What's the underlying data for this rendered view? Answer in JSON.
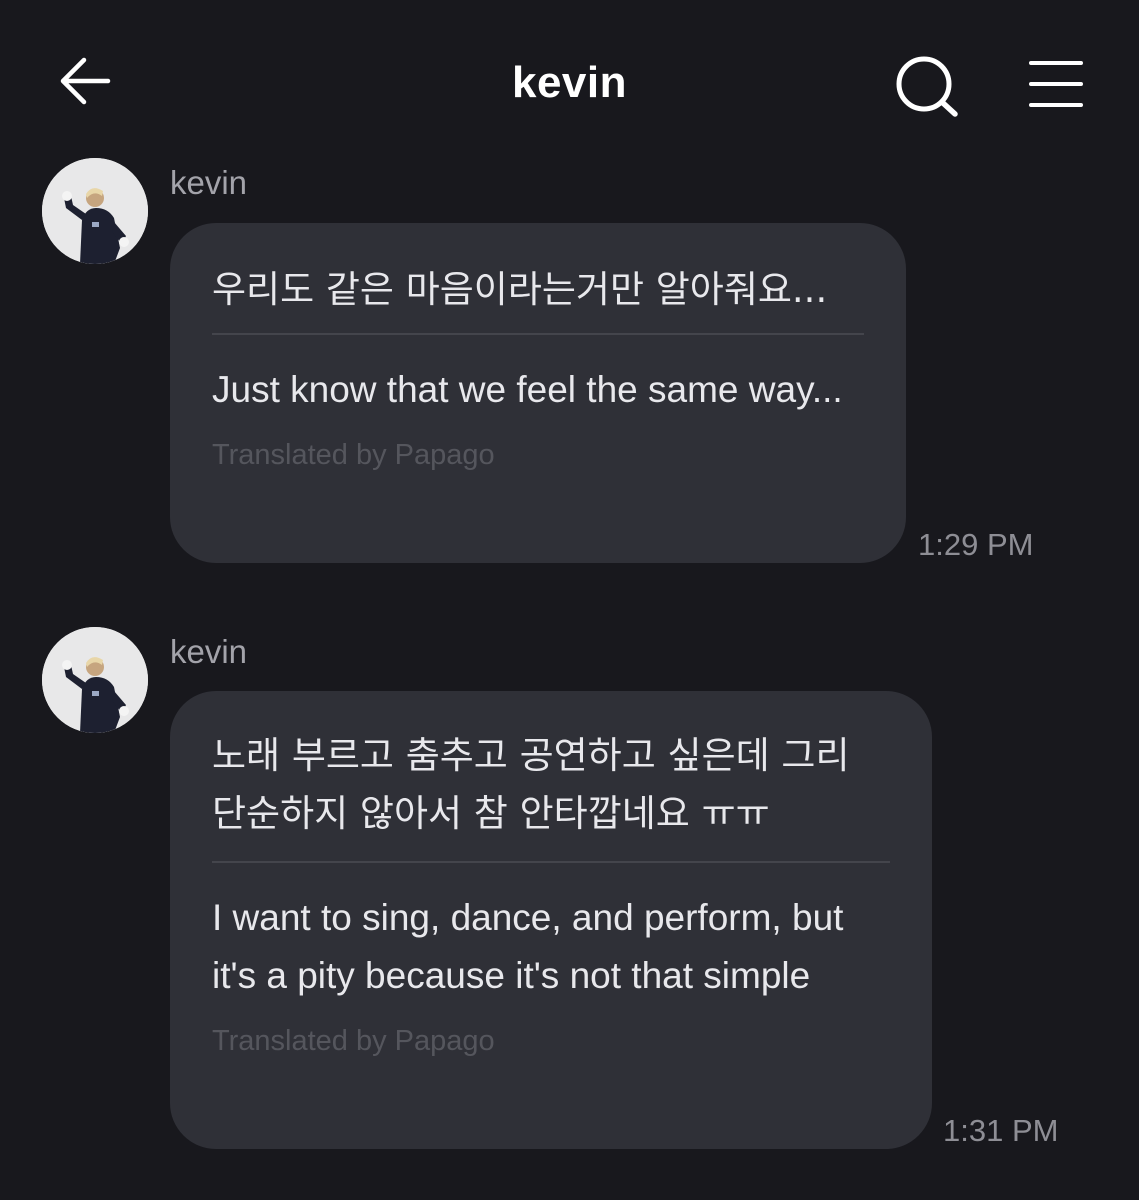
{
  "header": {
    "title": "kevin"
  },
  "messages": [
    {
      "sender": "kevin",
      "original": "우리도 같은 마음이라는거만 알아줘요...",
      "translation": "Just know that we feel the same way...",
      "translator_note": "Translated by Papago",
      "time": "1:29 PM"
    },
    {
      "sender": "kevin",
      "original": "노래 부르고 춤추고 공연하고 싶은데 그리 단순하지 않아서 참 안타깝네요 ㅠㅠ",
      "translation": "I want to sing, dance, and perform, but it's a pity because it's not that simple",
      "translator_note": "Translated by Papago",
      "time": "1:31 PM"
    }
  ],
  "colors": {
    "background": "#18181d",
    "bubble": "#2f3037",
    "divider": "#44454c",
    "text": "#e8e8ec",
    "muted": "#8e8e95"
  },
  "icons": [
    "back-arrow-icon",
    "search-icon",
    "menu-icon"
  ]
}
